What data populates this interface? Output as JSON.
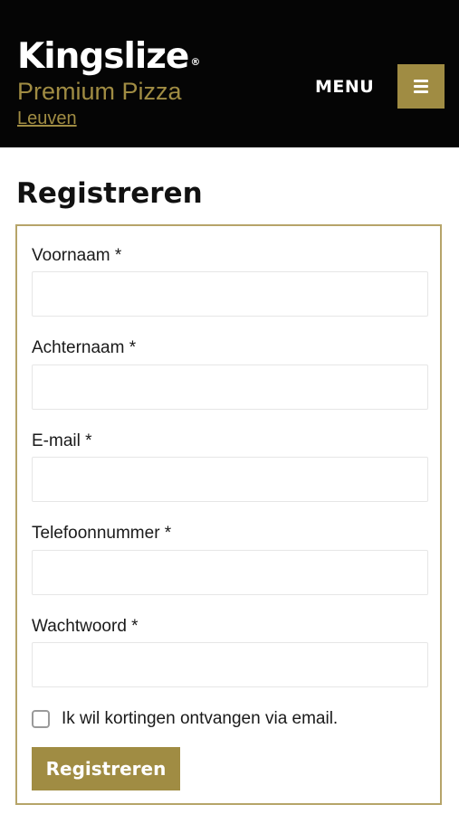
{
  "header": {
    "brand_name": "Kingslize",
    "registered_mark": "®",
    "brand_subtitle": "Premium Pizza",
    "city_link": "Leuven",
    "menu_label": "MENU",
    "menu_icon": "hamburger-icon"
  },
  "page": {
    "title": "Registreren"
  },
  "form": {
    "fields": [
      {
        "label": "Voornaam *",
        "value": ""
      },
      {
        "label": "Achternaam *",
        "value": ""
      },
      {
        "label": "E-mail *",
        "value": ""
      },
      {
        "label": "Telefoonnummer *",
        "value": ""
      },
      {
        "label": "Wachtwoord *",
        "value": ""
      }
    ],
    "newsletter_label": "Ik wil kortingen ontvangen via email.",
    "newsletter_checked": false,
    "submit_label": "Registreren"
  },
  "colors": {
    "accent": "#a08c43",
    "header_bg": "#050505",
    "form_border": "#b6a469"
  }
}
